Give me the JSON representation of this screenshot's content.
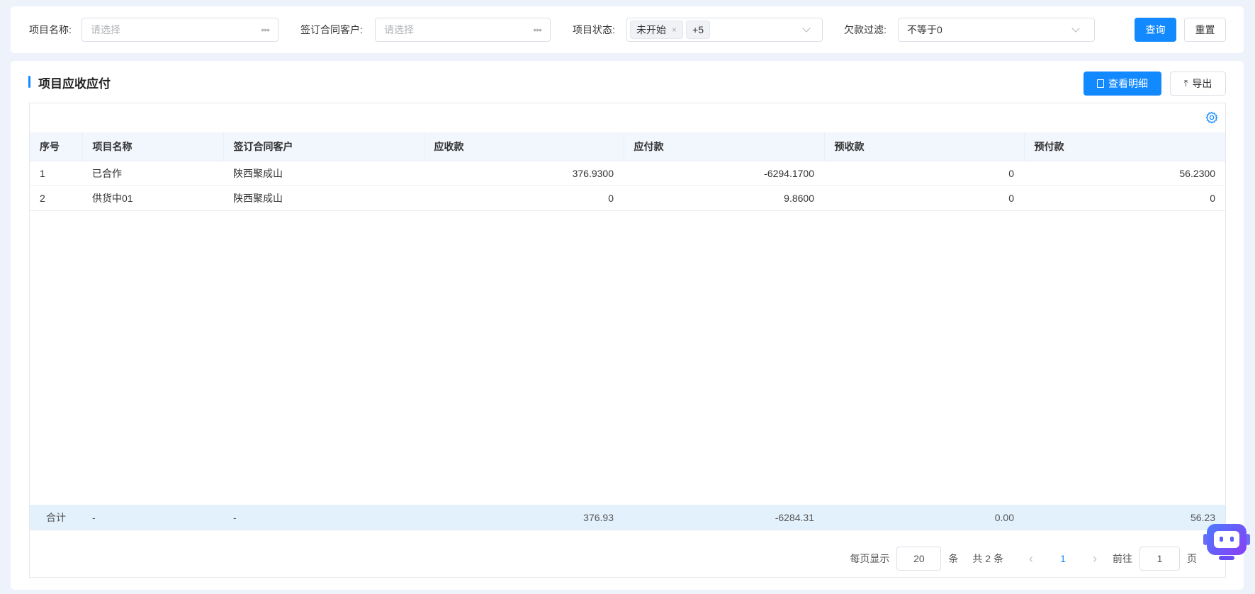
{
  "filters": {
    "project_name": {
      "label": "项目名称:",
      "placeholder": "请选择"
    },
    "customer": {
      "label": "签订合同客户:",
      "placeholder": "请选择"
    },
    "status": {
      "label": "项目状态:",
      "tags": [
        "未开始"
      ],
      "more": "+5"
    },
    "debt": {
      "label": "欠款过滤:",
      "value": "不等于0"
    },
    "query_label": "查询",
    "reset_label": "重置"
  },
  "main": {
    "title": "项目应收应付",
    "detail_label": "查看明细",
    "export_label": "导出",
    "accent": "#1389ff"
  },
  "table": {
    "columns": [
      "序号",
      "项目名称",
      "签订合同客户",
      "应收款",
      "应付款",
      "预收款",
      "预付款"
    ],
    "rows": [
      [
        "1",
        "已合作",
        "陕西聚成山",
        "376.9300",
        "-6294.1700",
        "0",
        "56.2300"
      ],
      [
        "2",
        "供货中01",
        "陕西聚成山",
        "0",
        "9.8600",
        "0",
        "0"
      ]
    ],
    "summary": [
      "合计",
      "-",
      "-",
      "376.93",
      "-6284.31",
      "0.00",
      "56.23"
    ]
  },
  "pagination": {
    "per_page_label": "每页显示",
    "per_page": "20",
    "unit": "条",
    "total": "共 2 条",
    "current_page": "1",
    "goto_label": "前往",
    "goto_value": "1",
    "page_unit": "页"
  }
}
